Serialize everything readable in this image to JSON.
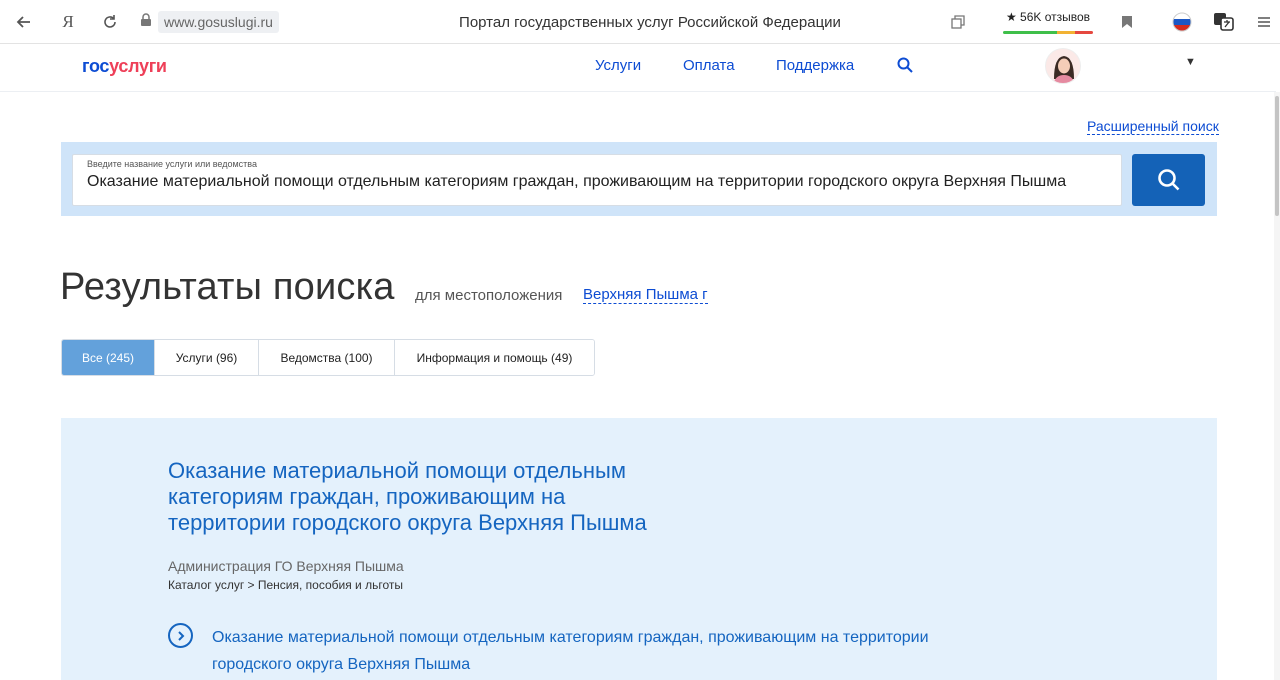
{
  "browser": {
    "url": "www.gosuslugi.ru",
    "page_title": "Портал государственных услуг Российской Федерации",
    "reviews_label": "★ 56K отзывов",
    "yandex_label": "Я"
  },
  "header": {
    "logo_part1": "гос",
    "logo_part2": "услуги",
    "nav": [
      "Услуги",
      "Оплата",
      "Поддержка"
    ]
  },
  "search": {
    "advanced_label": "Расширенный поиск",
    "field_label": "Введите название услуги или ведомства",
    "field_value": "Оказание материальной помощи отдельным категориям граждан, проживающим на территории городского округа Верхняя Пышма"
  },
  "results": {
    "title": "Результаты поиска",
    "location_label": "для местоположения",
    "location_value": "Верхняя Пышма г",
    "tabs": [
      {
        "label": "Все (245)"
      },
      {
        "label": "Услуги (96)"
      },
      {
        "label": "Ведомства (100)"
      },
      {
        "label": "Информация и помощь (49)"
      }
    ]
  },
  "result_card": {
    "title": "Оказание материальной помощи отдельным категориям граждан, проживающим на территории городского округа Верхняя Пышма",
    "organization": "Администрация ГО Верхняя Пышма",
    "path": "Каталог услуг > Пенсия, пособия и льготы",
    "sub_link": "Оказание материальной помощи отдельным категориям граждан, проживающим на территории городского округа Верхняя Пышма"
  },
  "colors": {
    "primary": "#0d4cd3",
    "link": "#1565c0",
    "logo_red": "#ee3f58",
    "tab_active": "#63a1db",
    "search_panel": "#cfe4f9",
    "card_bg": "#e4f1fc"
  }
}
